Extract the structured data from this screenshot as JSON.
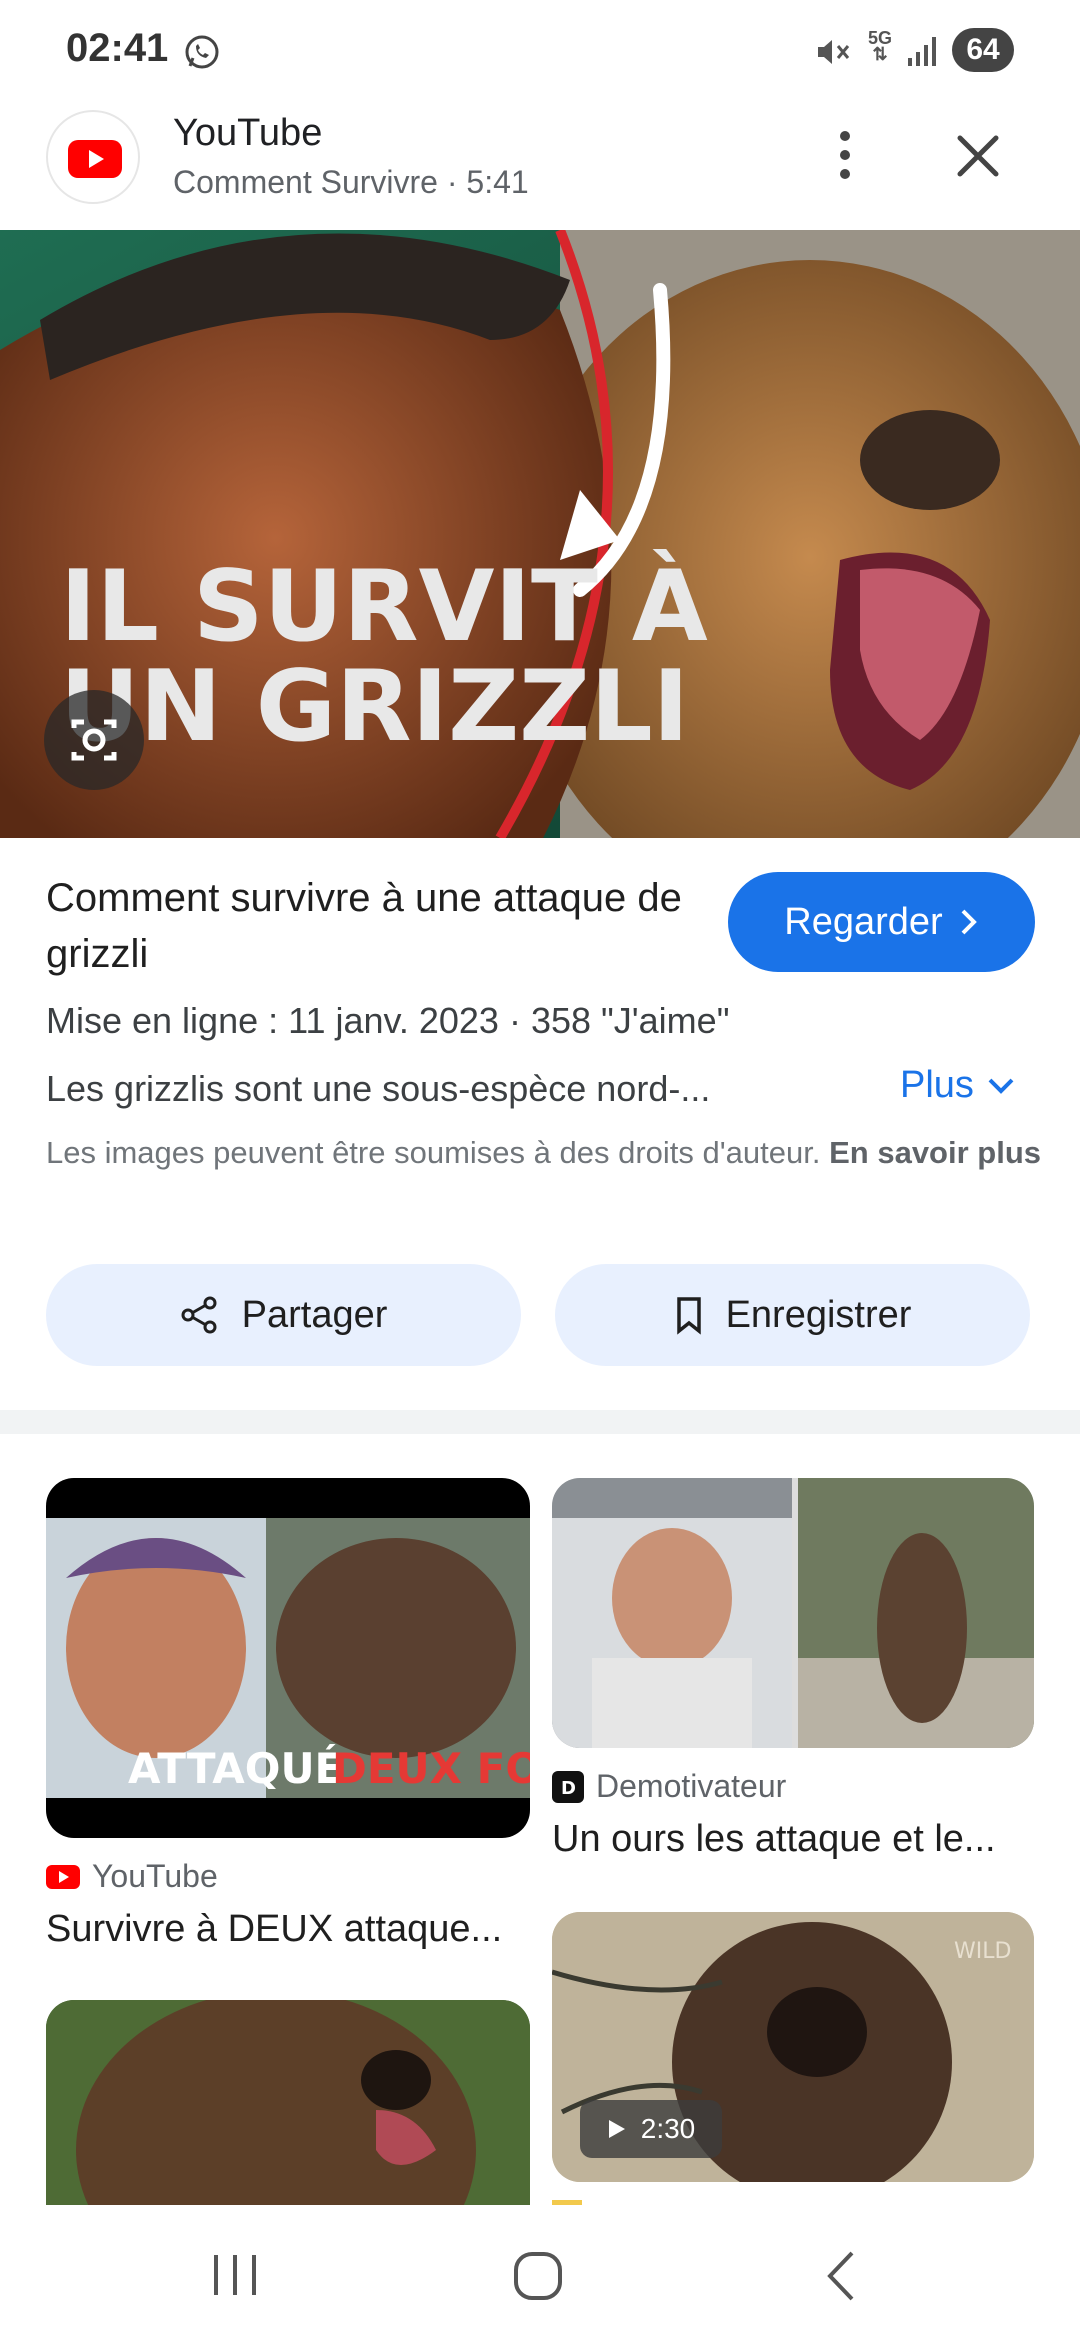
{
  "status_bar": {
    "time": "02:41",
    "network": "5G",
    "battery": "64",
    "icons": [
      "whatsapp-icon",
      "mute-icon",
      "signal-icon",
      "battery-icon"
    ]
  },
  "header": {
    "app_name": "YouTube",
    "subtitle": "Comment Survivre · 5:41",
    "icons": [
      "youtube-logo-icon",
      "more-vert-icon",
      "close-icon"
    ]
  },
  "hero": {
    "overlay_text_line1": "IL SURVIT À",
    "overlay_text_line2": "UN GRIZZLI",
    "icons": [
      "lens-icon"
    ]
  },
  "result": {
    "title": "Comment survivre à une attaque de grizzli",
    "watch_label": "Regarder",
    "meta": "Mise en ligne : 11 janv. 2023  ·  358 \"J'aime\"",
    "description": "Les grizzlis sont une sous-espèce nord-...",
    "more_label": "Plus",
    "copyright": "Les images peuvent être soumises à des droits d'auteur.",
    "learn_more": "En savoir plus",
    "share_label": "Partager",
    "save_label": "Enregistrer"
  },
  "related": [
    {
      "overlay_1": "ATTAQUÉ",
      "overlay_2": "DEUX FOIS",
      "source": "YouTube",
      "title": "Survivre à DEUX attaque..."
    },
    {
      "source": "Demotivateur",
      "title": "Un ours les attaque et le..."
    },
    {
      "duration": "2:30",
      "watermark": "WILD"
    },
    {}
  ],
  "colors": {
    "accent": "#1a73e8",
    "youtube_red": "#ff0000",
    "pill_bg": "#e8f0fe"
  }
}
